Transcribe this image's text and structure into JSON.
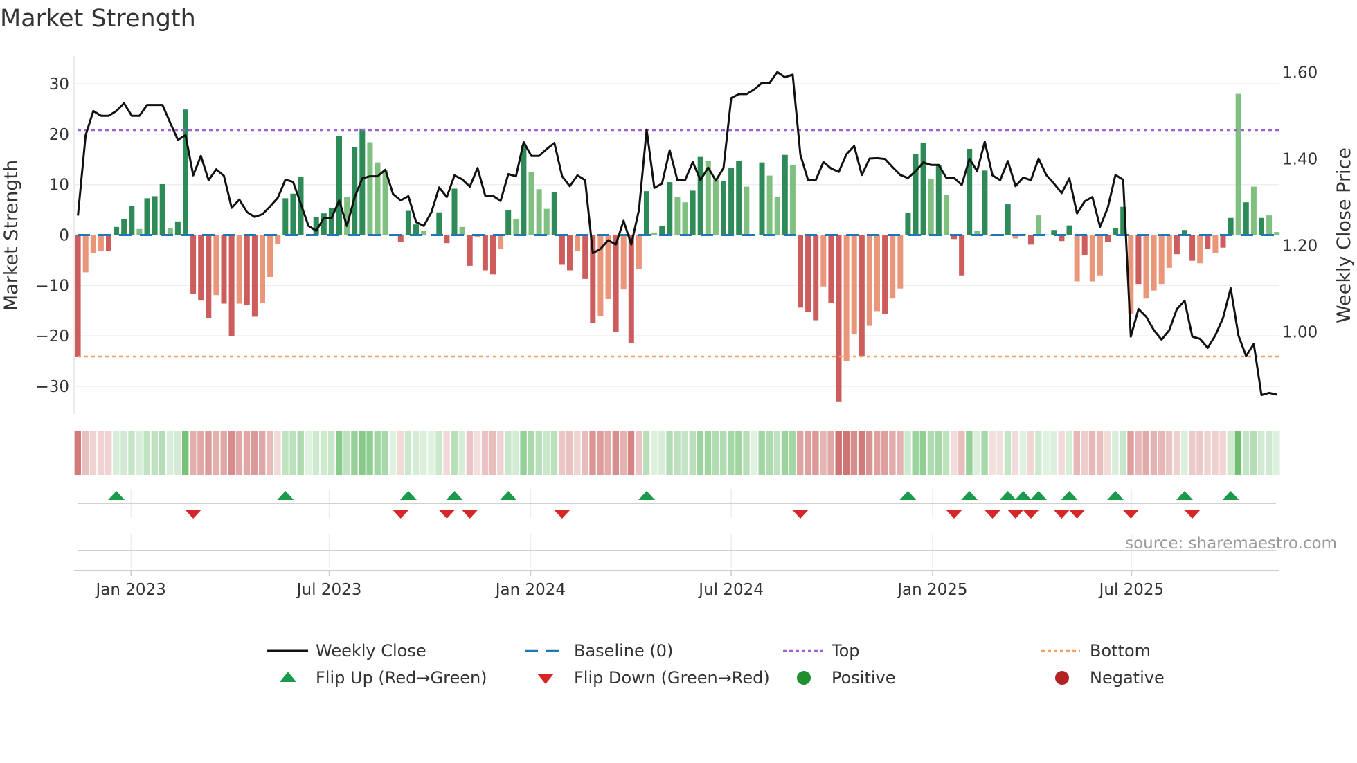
{
  "title": "Market Strength",
  "source": "source: sharemaestro.com",
  "colors": {
    "strong_pos": "#2e8b57",
    "weak_pos": "#7fbf7f",
    "strong_neg": "#cd5c5c",
    "weak_neg": "#e9967a",
    "line": "#111111",
    "baseline": "#1f77b4",
    "top": "#9b5fd6",
    "bottom": "#f0a060",
    "flip_up": "#1a9a4a",
    "flip_down": "#d62728",
    "positive": "#1f8f2f",
    "negative": "#b22222",
    "grid": "#eceef2"
  },
  "chart_data": {
    "type": "bar+line",
    "title": "Market Strength",
    "ylabel": "Market Strength",
    "y2label": "Weekly Close Price",
    "ylim": [
      -35.5,
      35.5
    ],
    "y2lim": [
      0.81,
      1.638
    ],
    "yticks": [
      {
        "v": 30,
        "label": "30"
      },
      {
        "v": 20,
        "label": "20"
      },
      {
        "v": 10,
        "label": "10"
      },
      {
        "v": 0,
        "label": "0"
      },
      {
        "v": -10,
        "label": "−10"
      },
      {
        "v": -20,
        "label": "−20"
      },
      {
        "v": -30,
        "label": "−30"
      }
    ],
    "y2ticks": [
      {
        "v": 1.6,
        "label": "1.60"
      },
      {
        "v": 1.4,
        "label": "1.40"
      },
      {
        "v": 1.2,
        "label": "1.20"
      },
      {
        "v": 1.0,
        "label": "1.00"
      }
    ],
    "xticks": [
      {
        "week": 6.9,
        "label": "Jan 2023"
      },
      {
        "week": 32.7,
        "label": "Jul 2023"
      },
      {
        "week": 58.9,
        "label": "Jan 2024"
      },
      {
        "week": 85.0,
        "label": "Jul 2024"
      },
      {
        "week": 111.2,
        "label": "Jan 2025"
      },
      {
        "week": 137.1,
        "label": "Jul 2025"
      }
    ],
    "top_level": 20.8,
    "bottom_level": -24.1,
    "strength": [
      -24.1,
      -7.4,
      -3.5,
      -3.2,
      -3.2,
      1.6,
      3.2,
      5.8,
      1.2,
      7.3,
      7.7,
      10.1,
      1.4,
      2.7,
      24.9,
      -11.6,
      -13,
      -16.5,
      -11.9,
      -13.6,
      -20,
      -13.6,
      -13.9,
      -16.2,
      -13.4,
      -8.3,
      -1.8,
      7.3,
      8.2,
      11.6,
      0,
      3.6,
      4.3,
      5.3,
      19.7,
      7.6,
      17.4,
      21.1,
      18.4,
      14.4,
      12.8,
      0,
      -1.4,
      4.8,
      2.1,
      0.8,
      0,
      4.5,
      -1.6,
      9.2,
      1.6,
      -6.1,
      -0.4,
      -7,
      -7.8,
      -2.8,
      4.9,
      3.1,
      17.8,
      12.5,
      9.1,
      5.2,
      8.5,
      -5.9,
      -7,
      -3.1,
      -8.7,
      -17.5,
      -16.1,
      -12.7,
      -19.2,
      -10.8,
      -21.4,
      -6.8,
      8.7,
      0.5,
      1.8,
      10.5,
      7.6,
      6.5,
      8.8,
      15.5,
      14.7,
      11,
      10.7,
      13.3,
      14.7,
      9.6,
      0,
      14.4,
      11.8,
      7.5,
      15.9,
      13.9,
      -14.4,
      -15.2,
      -16.9,
      -10.2,
      -13.5,
      -33,
      -25,
      -19.6,
      -24,
      -18,
      -15.1,
      -15.7,
      -12.6,
      -10.6,
      4.4,
      16.1,
      18.2,
      11.2,
      13.8,
      7.9,
      -0.8,
      -8,
      17.1,
      0.8,
      12.8,
      -0.2,
      0,
      6.1,
      -0.7,
      0.2,
      -1.9,
      3.9,
      0.1,
      1,
      -1.2,
      1.9,
      -9.2,
      -4,
      -9.2,
      -8,
      -1.4,
      1.3,
      5.6,
      -15.7,
      -9.7,
      -12.6,
      -11,
      -9.7,
      -6.5,
      -3.8,
      1,
      -5.1,
      -5.6,
      -2.8,
      -3.6,
      -2.5,
      3.4,
      28,
      6.5,
      9.6,
      3.4,
      3.9,
      0.6
    ],
    "shade": "dlllddddldddldddddlddlddlllddddddddlddlllddddlldddldlddldldllldddlddlldldldlddllddlldddlddlldldddlddlldlldlldddldldddlddddlddlddddldlldddldlllldddldlddldldl",
    "weekly_close": [
      1.269,
      1.455,
      1.511,
      1.5,
      1.5,
      1.511,
      1.529,
      1.5,
      1.5,
      1.525,
      1.525,
      1.525,
      1.484,
      1.444,
      1.455,
      1.362,
      1.407,
      1.351,
      1.376,
      1.361,
      1.287,
      1.306,
      1.277,
      1.266,
      1.272,
      1.29,
      1.31,
      1.352,
      1.347,
      1.296,
      1.245,
      1.234,
      1.263,
      1.263,
      1.304,
      1.245,
      1.311,
      1.355,
      1.36,
      1.36,
      1.375,
      1.319,
      1.304,
      1.314,
      1.254,
      1.245,
      1.277,
      1.334,
      1.312,
      1.362,
      1.353,
      1.336,
      1.379,
      1.315,
      1.315,
      1.303,
      1.365,
      1.36,
      1.439,
      1.407,
      1.407,
      1.423,
      1.437,
      1.36,
      1.337,
      1.362,
      1.351,
      1.182,
      1.192,
      1.212,
      1.202,
      1.257,
      1.202,
      1.282,
      1.468,
      1.333,
      1.343,
      1.42,
      1.351,
      1.351,
      1.393,
      1.351,
      1.38,
      1.35,
      1.379,
      1.541,
      1.55,
      1.55,
      1.561,
      1.576,
      1.576,
      1.601,
      1.589,
      1.595,
      1.41,
      1.351,
      1.351,
      1.393,
      1.378,
      1.37,
      1.411,
      1.43,
      1.363,
      1.401,
      1.402,
      1.4,
      1.381,
      1.363,
      1.356,
      1.372,
      1.392,
      1.386,
      1.386,
      1.356,
      1.356,
      1.34,
      1.4,
      1.372,
      1.44,
      1.362,
      1.351,
      1.395,
      1.337,
      1.357,
      1.351,
      1.401,
      1.363,
      1.343,
      1.321,
      1.355,
      1.274,
      1.302,
      1.312,
      1.243,
      1.287,
      1.363,
      1.352,
      0.989,
      1.053,
      1.035,
      1.004,
      0.982,
      1.004,
      1.053,
      1.072,
      0.989,
      0.984,
      0.963,
      0.992,
      1.032,
      1.101,
      0.992,
      0.944,
      0.972,
      0.854,
      0.859,
      0.855
    ],
    "flip_up_weeks": [
      5,
      27,
      43,
      49,
      56,
      74,
      108,
      116,
      121,
      123,
      125,
      129,
      135,
      144,
      150
    ],
    "flip_down_weeks": [
      15,
      42,
      48,
      51,
      63,
      94,
      114,
      119,
      122,
      124,
      128,
      130,
      137,
      145
    ],
    "legend": {
      "placement": "bottom",
      "items": [
        {
          "label": "Weekly Close",
          "symbol": "line"
        },
        {
          "label": "Baseline (0)",
          "symbol": "dash"
        },
        {
          "label": "Top",
          "symbol": "dot-purple"
        },
        {
          "label": "Bottom",
          "symbol": "dot-orange"
        },
        {
          "label": "Flip Up (Red→Green)",
          "symbol": "triangle-up"
        },
        {
          "label": "Flip Down (Green→Red)",
          "symbol": "triangle-down"
        },
        {
          "label": "Positive",
          "symbol": "circle-green"
        },
        {
          "label": "Negative",
          "symbol": "circle-red"
        }
      ]
    }
  }
}
